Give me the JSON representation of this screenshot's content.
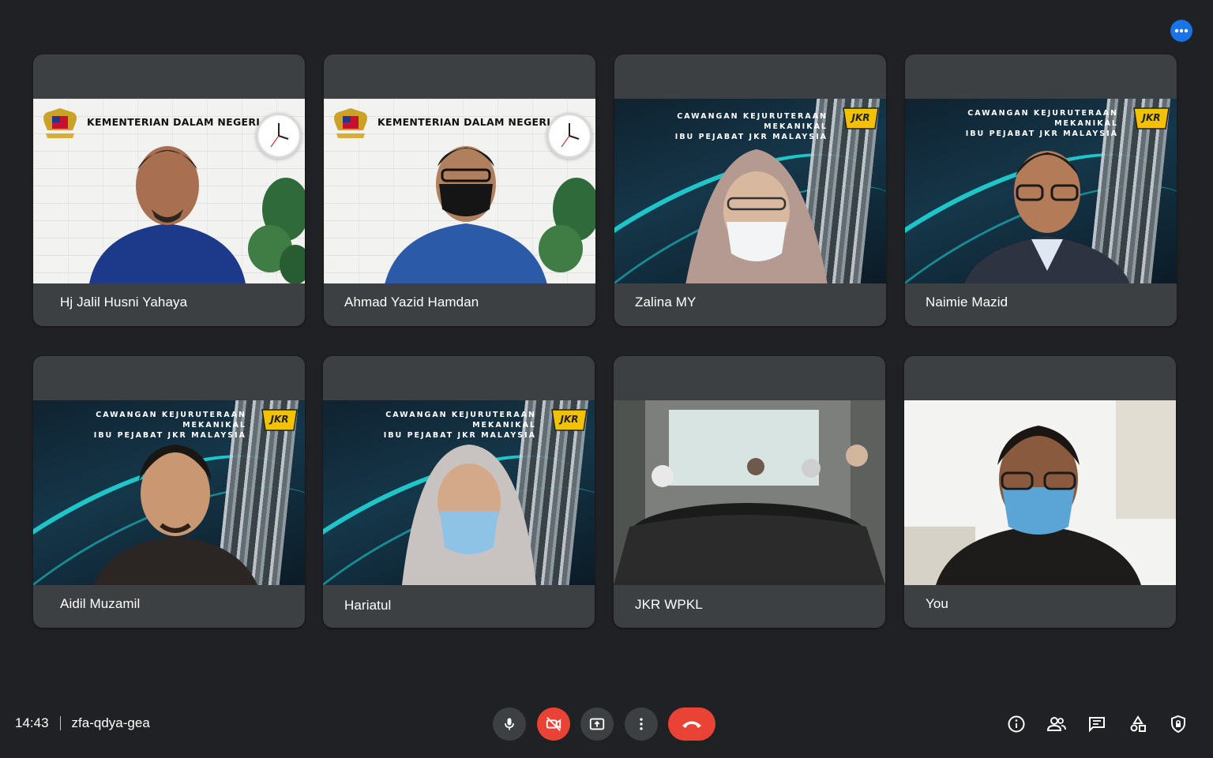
{
  "meeting": {
    "time": "14:43",
    "code": "zfa-qdya-gea"
  },
  "participants": [
    {
      "name": "Hj Jalil Husni Yahaya",
      "background": "KEMENTERIAN DALAM NEGERI"
    },
    {
      "name": "Ahmad Yazid Hamdan",
      "background": "KEMENTERIAN DALAM NEGERI"
    },
    {
      "name": "Zalina MY",
      "background_line1": "CAWANGAN KEJURUTERAAN MEKANIKAL",
      "background_line2": "IBU PEJABAT JKR MALAYSIA"
    },
    {
      "name": "Naimie Mazid",
      "background_line1": "CAWANGAN KEJURUTERAAN MEKANIKAL",
      "background_line2": "IBU PEJABAT JKR MALAYSIA"
    },
    {
      "name": "Aidil Muzamil",
      "background_line1": "CAWANGAN KEJURUTERAAN MEKANIKAL",
      "background_line2": "IBU PEJABAT JKR MALAYSIA"
    },
    {
      "name": "Hariatul",
      "background_line1": "CAWANGAN KEJURUTERAAN MEKANIKAL",
      "background_line2": "IBU PEJABAT JKR MALAYSIA"
    },
    {
      "name": "JKR WPKL"
    },
    {
      "name": "You"
    }
  ],
  "jkr_logo_text": "JKR",
  "colors": {
    "background": "#202124",
    "tile": "#3c4043",
    "accent_blue": "#1a73e8",
    "danger_red": "#ea4335"
  },
  "controls": {
    "mic": "microphone-icon",
    "camera": "camera-off-icon",
    "present": "present-screen-icon",
    "more": "more-vert-icon",
    "end_call": "end-call-icon"
  },
  "side_controls": [
    "info-icon",
    "people-icon",
    "chat-icon",
    "activities-icon",
    "host-controls-icon"
  ]
}
